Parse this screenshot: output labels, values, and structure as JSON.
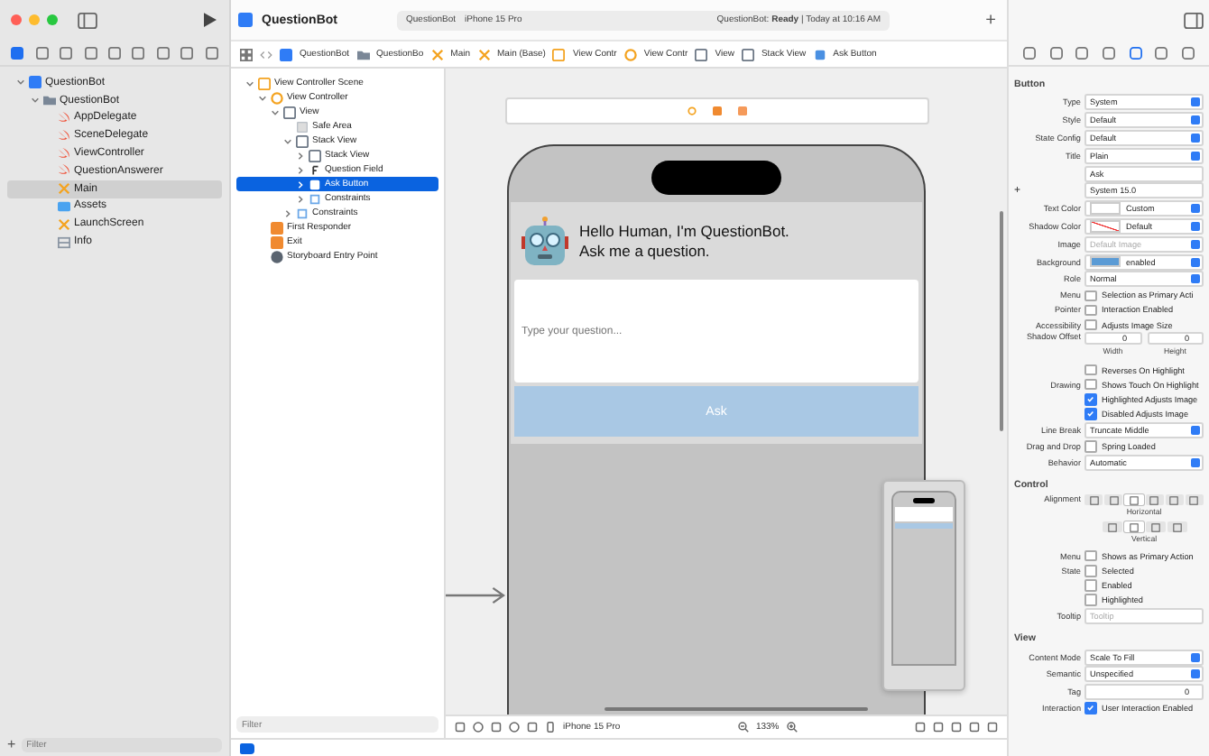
{
  "window": {
    "title": "QuestionBot",
    "scheme": "QuestionBot",
    "device": "iPhone 15 Pro",
    "status_app": "QuestionBot:",
    "status": "Ready",
    "status_time": "| Today at 10:16 AM",
    "add": "+"
  },
  "breadcrumbs": [
    {
      "label": "QuestionBot",
      "kind": "project"
    },
    {
      "label": "QuestionBo",
      "kind": "folder"
    },
    {
      "label": "Main",
      "kind": "storyboard"
    },
    {
      "label": "Main (Base)",
      "kind": "storyboard"
    },
    {
      "label": "View Contr",
      "kind": "scene"
    },
    {
      "label": "View Contr",
      "kind": "controller"
    },
    {
      "label": "View",
      "kind": "view"
    },
    {
      "label": "Stack View",
      "kind": "view"
    },
    {
      "label": "Ask Button",
      "kind": "button"
    }
  ],
  "navigator": {
    "items": [
      {
        "label": "QuestionBot",
        "kind": "project",
        "expanded": true,
        "selected": false,
        "children": [
          {
            "label": "QuestionBot",
            "kind": "folder",
            "expanded": true,
            "selected": false,
            "children": [
              {
                "label": "AppDelegate",
                "kind": "swift",
                "selected": false
              },
              {
                "label": "SceneDelegate",
                "kind": "swift",
                "selected": false
              },
              {
                "label": "ViewController",
                "kind": "swift",
                "selected": false
              },
              {
                "label": "QuestionAnswerer",
                "kind": "swift",
                "selected": false
              },
              {
                "label": "Main",
                "kind": "storyboard",
                "selected": true
              },
              {
                "label": "Assets",
                "kind": "assets",
                "selected": false
              },
              {
                "label": "LaunchScreen",
                "kind": "storyboard",
                "selected": false
              },
              {
                "label": "Info",
                "kind": "plist",
                "selected": false
              }
            ]
          }
        ]
      }
    ],
    "filter_placeholder": "Filter",
    "add": "+"
  },
  "debug": {
    "breakpoints_on": true
  },
  "outline": {
    "items": [
      {
        "label": "View Controller Scene",
        "kind": "scene",
        "expanded": true,
        "selected": false,
        "children": [
          {
            "label": "View Controller",
            "kind": "controller",
            "expanded": true,
            "selected": false,
            "children": [
              {
                "label": "View",
                "kind": "view",
                "expanded": true,
                "selected": false,
                "children": [
                  {
                    "label": "Safe Area",
                    "kind": "safe-area",
                    "selected": false
                  },
                  {
                    "label": "Stack View",
                    "kind": "view",
                    "expanded": true,
                    "selected": false,
                    "children": [
                      {
                        "label": "Stack View",
                        "kind": "view",
                        "expanded": false,
                        "selected": false
                      },
                      {
                        "label": "Question Field",
                        "kind": "field",
                        "expanded": false,
                        "selected": false
                      },
                      {
                        "label": "Ask Button",
                        "kind": "button",
                        "expanded": false,
                        "selected": true
                      },
                      {
                        "label": "Constraints",
                        "kind": "constraints",
                        "expanded": false,
                        "selected": false
                      }
                    ]
                  },
                  {
                    "label": "Constraints",
                    "kind": "constraints",
                    "expanded": false,
                    "selected": false
                  }
                ]
              }
            ]
          },
          {
            "label": "First Responder",
            "kind": "responder",
            "selected": false
          },
          {
            "label": "Exit",
            "kind": "exit",
            "selected": false
          },
          {
            "label": "Storyboard Entry Point",
            "kind": "entry",
            "selected": false
          }
        ]
      }
    ],
    "filter_placeholder": "Filter"
  },
  "canvas": {
    "greeting": [
      "Hello Human, I'm QuestionBot.",
      "Ask me a question."
    ],
    "field_placeholder": "Type your question...",
    "button": "Ask"
  },
  "canvas_bar": {
    "device": "iPhone 15 Pro",
    "zoom": "133%"
  },
  "inspector": {
    "sections": [
      {
        "title": "Button",
        "rows": [
          {
            "kind": "select",
            "label": "Type",
            "value": "System"
          },
          {
            "kind": "select",
            "label": "Style",
            "value": "Default"
          },
          {
            "kind": "select",
            "label": "State Config",
            "value": "Default"
          },
          {
            "kind": "select",
            "label": "Title",
            "value": "Plain"
          },
          {
            "kind": "text",
            "label": "",
            "value": "Ask"
          },
          {
            "kind": "font",
            "label": "+",
            "value": "System 15.0"
          },
          {
            "kind": "color",
            "label": "Text Color",
            "value": "Custom",
            "color": "#ffffff"
          },
          {
            "kind": "color-none",
            "label": "Shadow Color",
            "value": "Default"
          },
          {
            "kind": "select",
            "label": "Image",
            "placeholder": "Default Image"
          },
          {
            "kind": "color",
            "label": "Background",
            "value": "enabled",
            "color": "#5b9bd5"
          },
          {
            "kind": "select",
            "label": "Role",
            "value": "Normal"
          },
          {
            "kind": "check",
            "label": "Menu",
            "text": "Selection as Primary Acti",
            "checked": false
          },
          {
            "kind": "check",
            "label": "Pointer",
            "text": "Interaction Enabled",
            "checked": false
          },
          {
            "kind": "check",
            "label": "Accessibility",
            "text": "Adjusts Image Size",
            "checked": false
          },
          {
            "kind": "offset",
            "label": "Shadow Offset",
            "values": [
              "0",
              "0"
            ],
            "captions": [
              "Width",
              "Height"
            ]
          },
          {
            "kind": "check",
            "label": "",
            "text": "Reverses On Highlight",
            "checked": false
          },
          {
            "kind": "check",
            "label": "Drawing",
            "text": "Shows Touch On Highlight",
            "checked": false
          },
          {
            "kind": "check",
            "label": "",
            "text": "Highlighted Adjusts Image",
            "checked": true
          },
          {
            "kind": "check",
            "label": "",
            "text": "Disabled Adjusts Image",
            "checked": true
          },
          {
            "kind": "select",
            "label": "Line Break",
            "value": "Truncate Middle"
          },
          {
            "kind": "check",
            "label": "Drag and Drop",
            "text": "Spring Loaded",
            "checked": false
          },
          {
            "kind": "select",
            "label": "Behavior",
            "value": "Automatic"
          }
        ]
      },
      {
        "title": "Control",
        "rows": [
          {
            "kind": "segments",
            "label": "Alignment",
            "caption": "Horizontal",
            "items": [
              {
                "selected": false
              },
              {
                "selected": false
              },
              {
                "selected": true
              },
              {
                "selected": false
              },
              {
                "selected": false
              },
              {
                "selected": false
              }
            ]
          },
          {
            "kind": "segments",
            "label": "",
            "caption": "Vertical",
            "items": [
              {
                "selected": false
              },
              {
                "selected": true
              },
              {
                "selected": false
              },
              {
                "selected": false
              }
            ]
          },
          {
            "kind": "check",
            "label": "Menu",
            "text": "Shows as Primary Action",
            "checked": false
          },
          {
            "kind": "check",
            "label": "State",
            "text": "Selected",
            "checked": false
          },
          {
            "kind": "check",
            "label": "",
            "text": "Enabled",
            "checked": false
          },
          {
            "kind": "check",
            "label": "",
            "text": "Highlighted",
            "checked": false
          },
          {
            "kind": "text",
            "label": "Tooltip",
            "placeholder": "Tooltip"
          }
        ]
      },
      {
        "title": "View",
        "rows": [
          {
            "kind": "select",
            "label": "Content Mode",
            "value": "Scale To Fill"
          },
          {
            "kind": "select",
            "label": "Semantic",
            "value": "Unspecified"
          },
          {
            "kind": "stepper",
            "label": "Tag",
            "value": "0"
          },
          {
            "kind": "check",
            "label": "Interaction",
            "text": "User Interaction Enabled",
            "checked": true
          }
        ]
      }
    ]
  }
}
